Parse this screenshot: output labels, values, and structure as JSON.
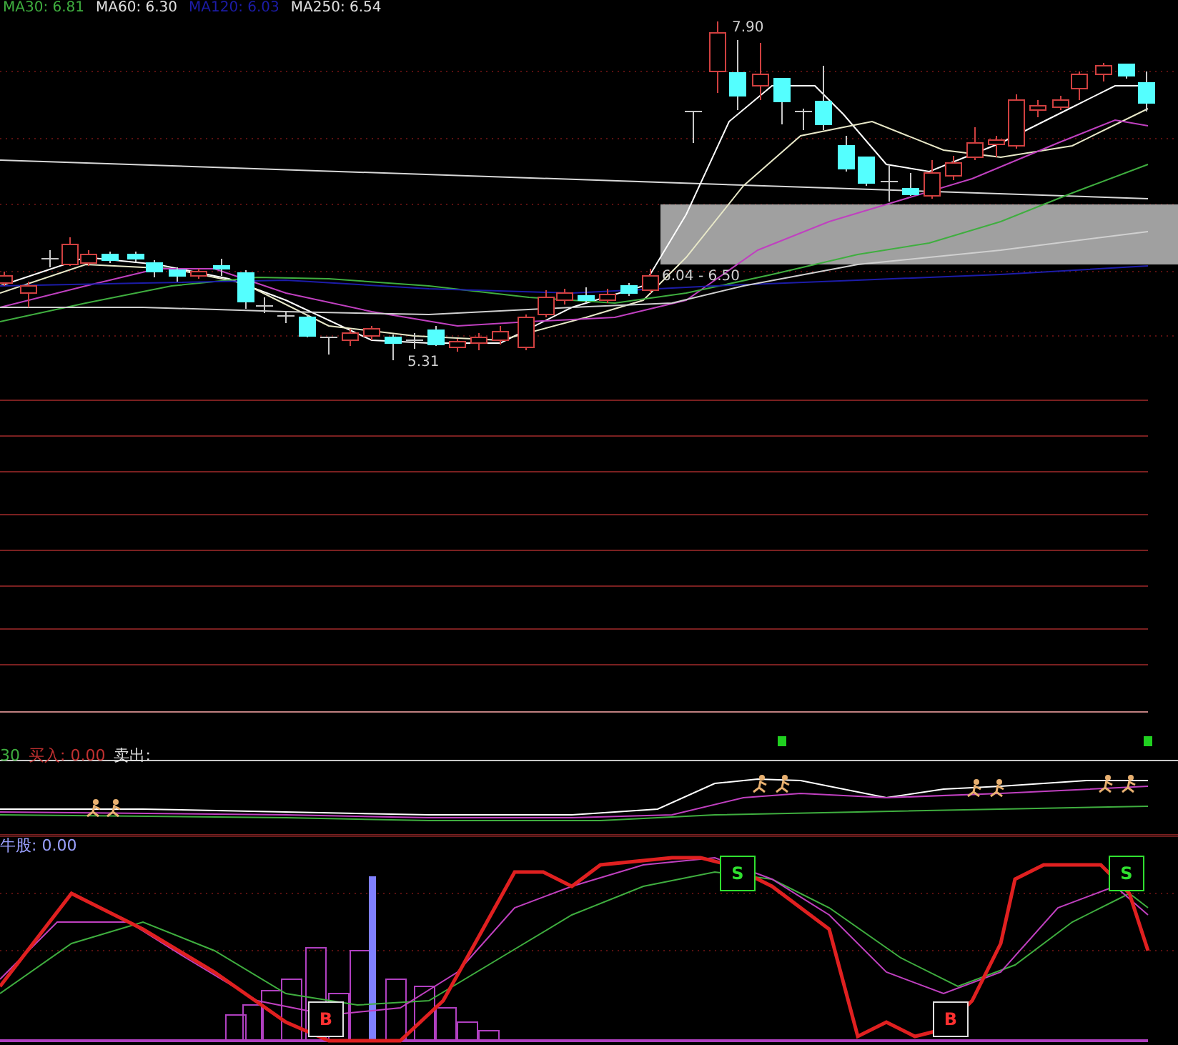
{
  "legend": [
    {
      "label": "MA30: 6.81",
      "color": "#3fae3f"
    },
    {
      "label": "MA60: 6.30",
      "color": "#e0e0e0"
    },
    {
      "label": "MA120: 6.03",
      "color": "#1c1ca8"
    },
    {
      "label": "MA250: 6.54",
      "color": "#e0e0e0"
    }
  ],
  "annotations": {
    "high": "7.90",
    "low": "5.31",
    "range": "6.04 - 6.50"
  },
  "indicator": {
    "labels": [
      {
        "text": "30",
        "color": "#3fae3f"
      },
      {
        "text": "买入: 0.00",
        "color": "#c03030"
      },
      {
        "text": "卖出:",
        "color": "#e0e0e0"
      }
    ]
  },
  "oscillator": {
    "label": "牛股: 0.00",
    "signals": [
      {
        "kind": "buy",
        "label": "B"
      },
      {
        "kind": "sell",
        "label": "S"
      },
      {
        "kind": "buy",
        "label": "B"
      },
      {
        "kind": "sell",
        "label": "S"
      }
    ]
  }
}
